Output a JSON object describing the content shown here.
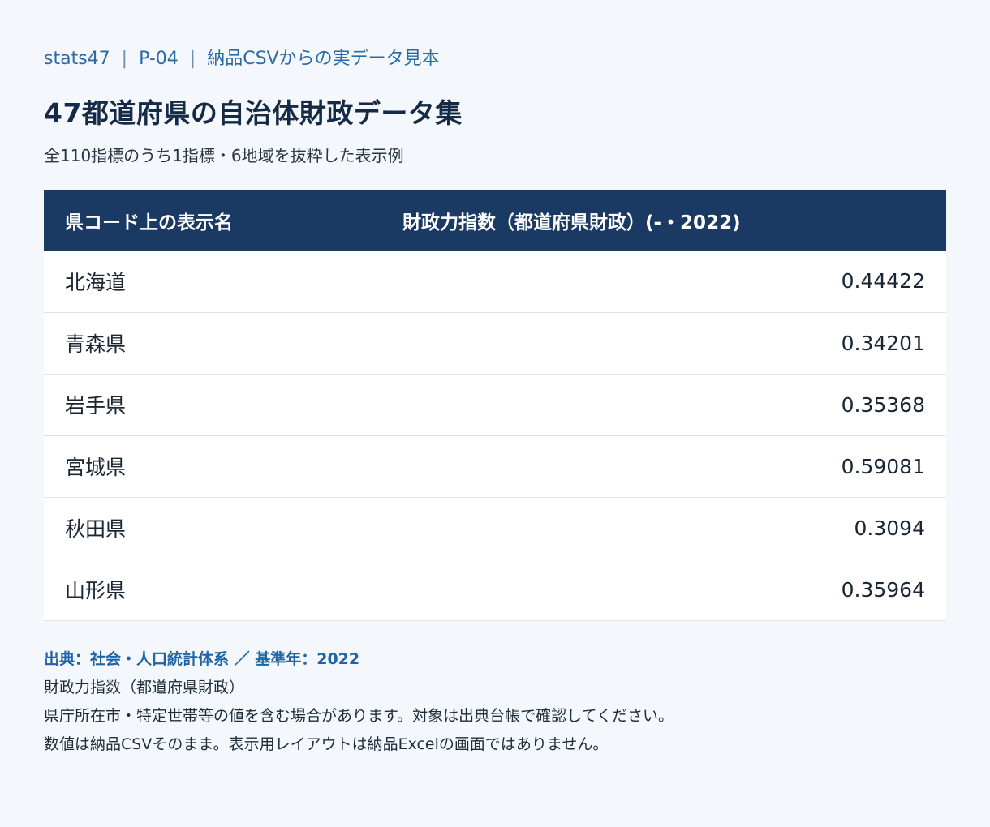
{
  "breadcrumb": {
    "site": "stats47",
    "code": "P-04",
    "label": "納品CSVからの実データ見本"
  },
  "page_title": "47都道府県の自治体財政データ集",
  "subtitle": "全110指標のうち1指標・6地域を抜粋した表示例",
  "table": {
    "headers": [
      "県コード上の表示名",
      "財政力指数（都道府県財政）(-・2022)"
    ],
    "rows": [
      {
        "name": "北海道",
        "value": "0.44422"
      },
      {
        "name": "青森県",
        "value": "0.34201"
      },
      {
        "name": "岩手県",
        "value": "0.35368"
      },
      {
        "name": "宮城県",
        "value": "0.59081"
      },
      {
        "name": "秋田県",
        "value": "0.3094"
      },
      {
        "name": "山形県",
        "value": "0.35964"
      }
    ]
  },
  "notes": {
    "source": "出典：社会・人口統計体系 ／ 基準年：2022",
    "lines": [
      "財政力指数（都道府県財政）",
      "県庁所在市・特定世帯等の値を含む場合があります。対象は出典台帳で確認してください。",
      "数値は納品CSVそのまま。表示用レイアウトは納品Excelの画面ではありません。"
    ]
  }
}
